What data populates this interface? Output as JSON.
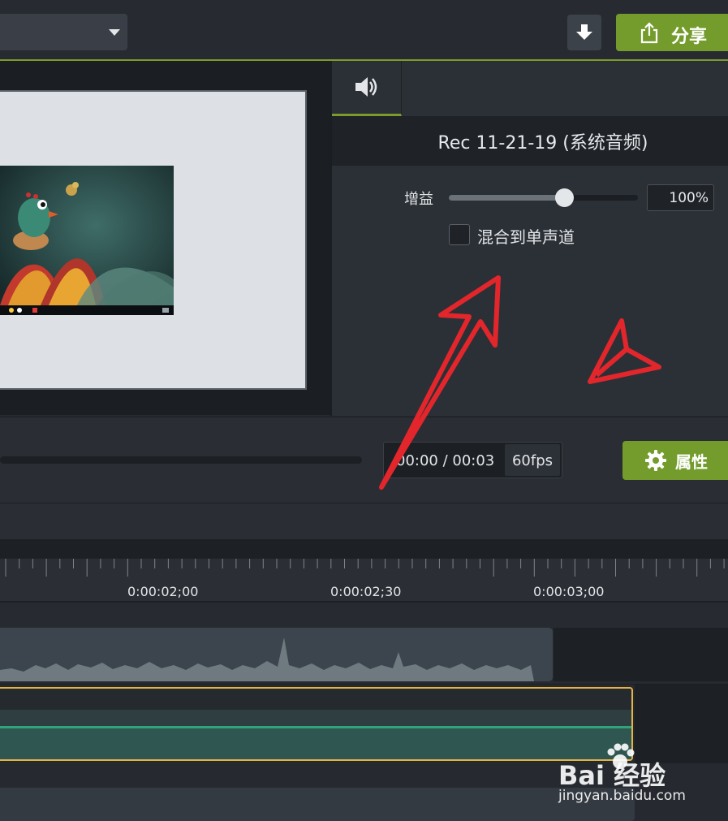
{
  "top_bar": {
    "share_label": "分享"
  },
  "properties_panel": {
    "clip_title": "Rec 11-21-19 (系统音频)",
    "gain_label": "增益",
    "gain_value": "100%",
    "gain_level": 0.61,
    "mix_to_mono_label": "混合到单声道",
    "mix_to_mono_checked": false
  },
  "playback": {
    "time_readout": "00:00 / 00:03",
    "fps": "60fps",
    "properties_button_label": "属性"
  },
  "timeline": {
    "ruler_labels": [
      "0:00:02;00",
      "0:00:02;30",
      "0:00:03;00"
    ]
  },
  "watermark": {
    "logo_text": "Bai 经验",
    "url": "jingyan.baidu.com"
  },
  "colors": {
    "accent_green": "#749c2c",
    "annotation_red": "#e3262b",
    "selection_yellow": "#e2b448",
    "audio_teal": "#2f5650"
  },
  "icons": [
    "dropdown-caret-icon",
    "download-icon",
    "share-icon",
    "speaker-icon",
    "gear-icon",
    "baidu-paw-icon"
  ]
}
